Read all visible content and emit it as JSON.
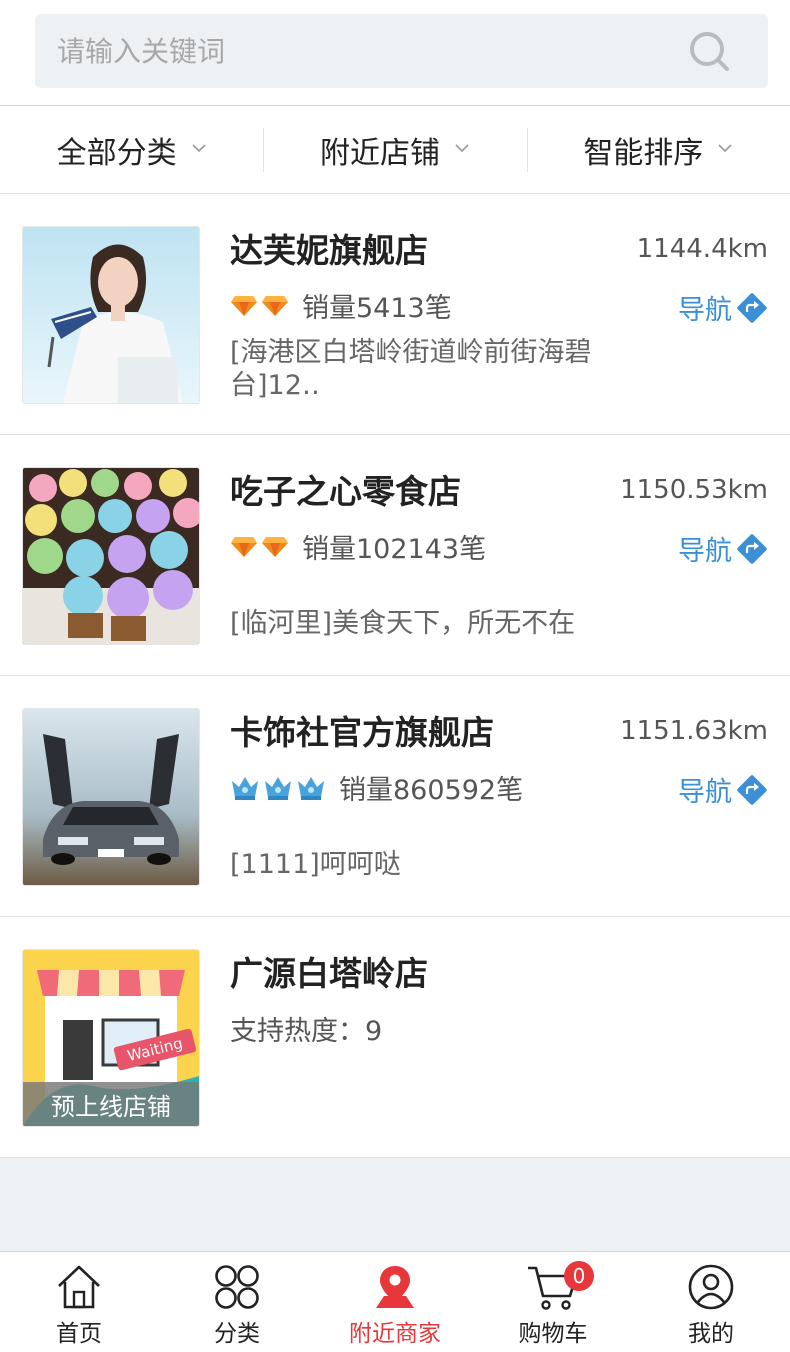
{
  "search": {
    "placeholder": "请输入关键词"
  },
  "filters": [
    {
      "label": "全部分类"
    },
    {
      "label": "附近店铺"
    },
    {
      "label": "智能排序"
    }
  ],
  "stores": [
    {
      "name": "达芙妮旗舰店",
      "distance": "1144.4km",
      "rank_icon": "diamond-icon",
      "rank_count": 2,
      "sales": "销量5413笔",
      "nav": "导航",
      "address": "[海港区白塔岭街道岭前街海碧台]12‥"
    },
    {
      "name": "吃子之心零食店",
      "distance": "1150.53km",
      "rank_icon": "diamond-icon",
      "rank_count": 2,
      "sales": "销量102143笔",
      "nav": "导航",
      "address": "[临河里]美食天下，所无不在"
    },
    {
      "name": "卡饰社官方旗舰店",
      "distance": "1151.63km",
      "rank_icon": "crown-icon",
      "rank_count": 3,
      "sales": "销量860592笔",
      "nav": "导航",
      "address": "[1111]呵呵哒"
    },
    {
      "name": "广源白塔岭店",
      "heat": "支持热度：9",
      "thumb_label": "预上线店铺",
      "thumb_sign": "Waiting"
    }
  ],
  "tabbar": [
    {
      "label": "首页",
      "icon": "home-icon"
    },
    {
      "label": "分类",
      "icon": "category-icon"
    },
    {
      "label": "附近商家",
      "icon": "location-icon",
      "active": true
    },
    {
      "label": "购物车",
      "icon": "cart-icon",
      "badge": "0"
    },
    {
      "label": "我的",
      "icon": "profile-icon"
    }
  ],
  "colors": {
    "accent": "#e8373a",
    "link": "#3b8fd6",
    "background": "#eef1f4"
  }
}
